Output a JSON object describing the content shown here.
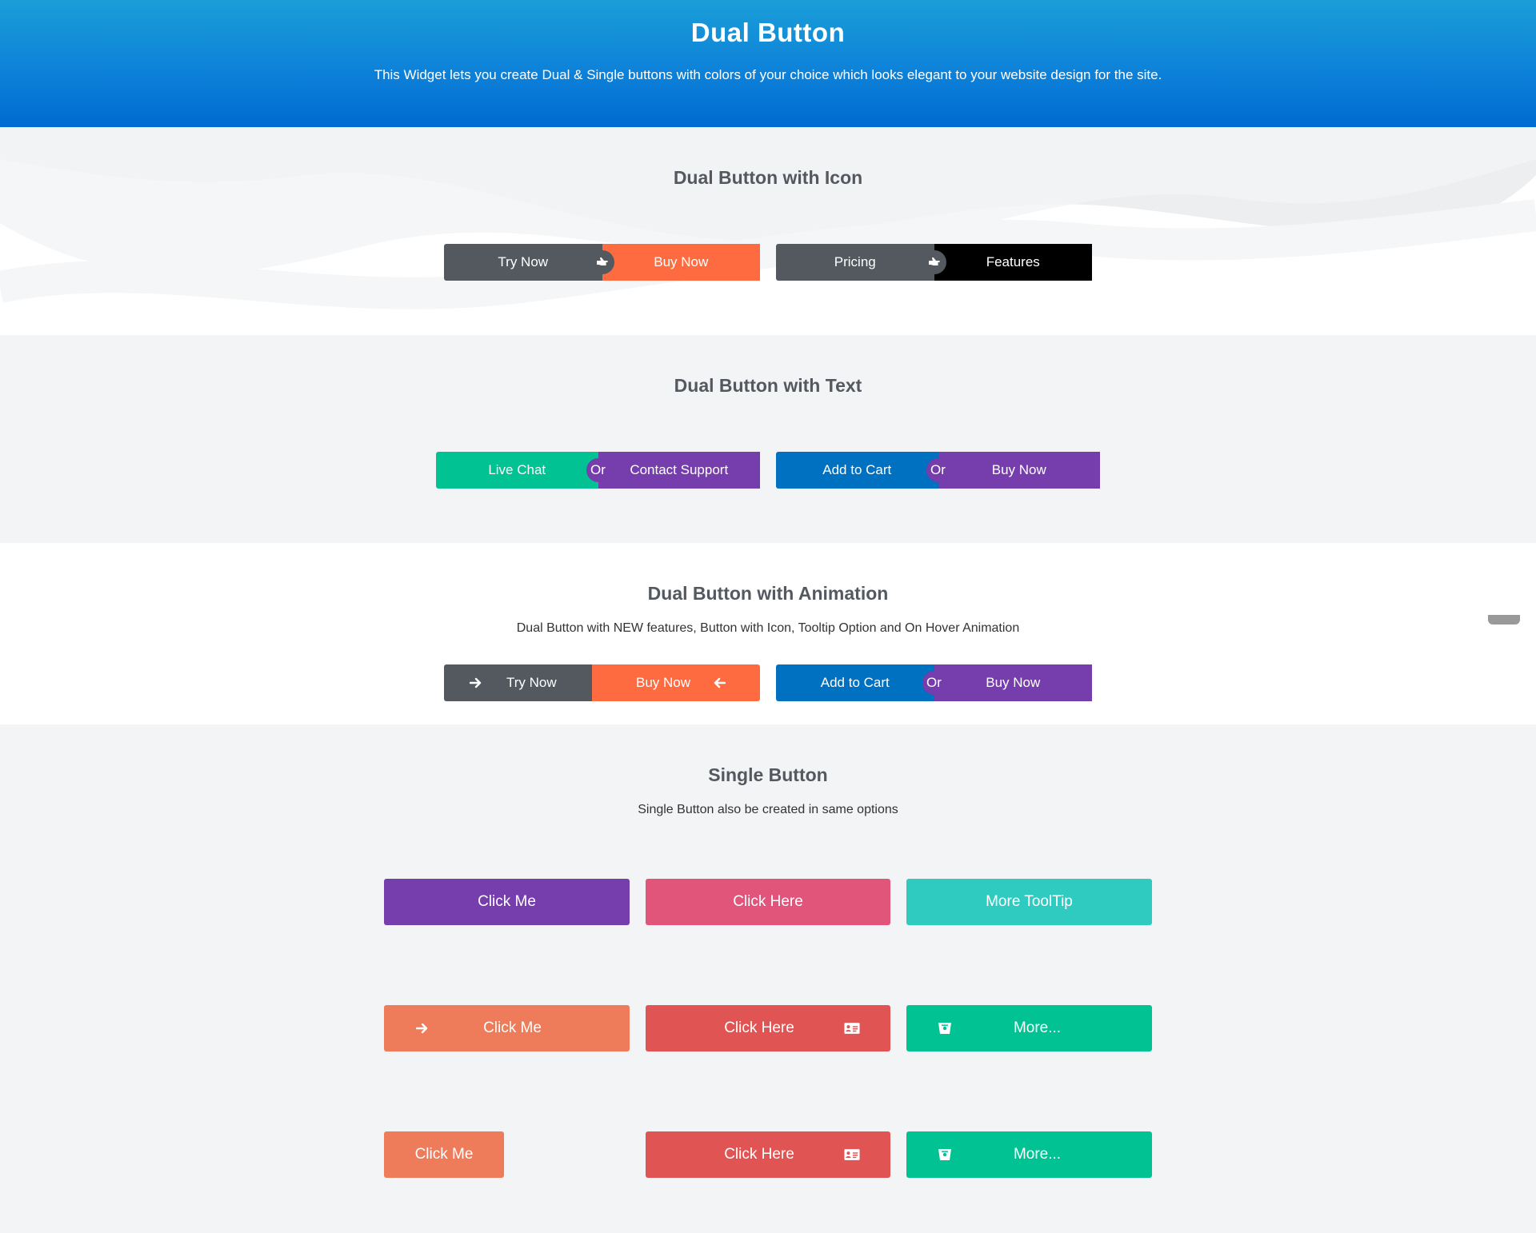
{
  "hero": {
    "title": "Dual Button",
    "subtitle": "This Widget lets you create Dual & Single buttons with colors of your choice which looks elegant to your website design for the site."
  },
  "section_icon": {
    "title": "Dual Button with Icon",
    "buttons": [
      {
        "left": "Try Now",
        "right": "Buy Now",
        "separator_icon": "hand-pointer-icon"
      },
      {
        "left": "Pricing",
        "right": "Features",
        "separator_icon": "hand-pointer-icon"
      }
    ]
  },
  "section_text": {
    "title": "Dual Button with Text",
    "buttons": [
      {
        "left": "Live Chat",
        "right": "Contact Support",
        "separator": "Or"
      },
      {
        "left": "Add to Cart",
        "right": "Buy Now",
        "separator": "Or"
      }
    ]
  },
  "section_animation": {
    "title": "Dual Button with Animation",
    "subtitle": "Dual Button with NEW features,  Button with Icon, Tooltip Option and On Hover Animation",
    "buttons": [
      {
        "left": "Try Now",
        "right": "Buy Now",
        "left_icon": "arrow-right-icon",
        "right_icon": "arrow-left-icon"
      },
      {
        "left": "Add to Cart",
        "right": "Buy Now",
        "separator": "Or"
      }
    ]
  },
  "section_single": {
    "title": "Single Button",
    "subtitle": "Single Button also be created in same options",
    "row1": [
      "Click Me",
      "Click Here",
      "More ToolTip"
    ],
    "row2": [
      "Click Me",
      "Click Here",
      "More..."
    ],
    "row3": [
      "Click Me",
      "Click Here",
      "More..."
    ],
    "icons": {
      "arrow": "arrow-right-icon",
      "card": "id-card-icon",
      "bag": "bitbucket-icon"
    }
  },
  "colors": {
    "dark_gray": "#54595f",
    "orange": "#fe6b40",
    "black": "#000000",
    "green": "#00c292",
    "purple": "#763dac",
    "blue": "#0070c0",
    "pink": "#e05579",
    "teal": "#2fcbc0",
    "salmon": "#ee7b5a",
    "red": "#e05553"
  }
}
